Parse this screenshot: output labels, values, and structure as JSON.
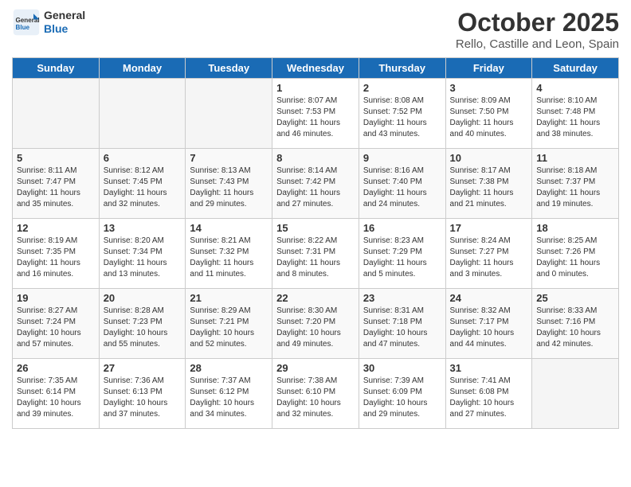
{
  "header": {
    "logo_line1": "General",
    "logo_line2": "Blue",
    "month": "October 2025",
    "location": "Rello, Castille and Leon, Spain"
  },
  "days_of_week": [
    "Sunday",
    "Monday",
    "Tuesday",
    "Wednesday",
    "Thursday",
    "Friday",
    "Saturday"
  ],
  "weeks": [
    [
      {
        "day": "",
        "empty": true
      },
      {
        "day": "",
        "empty": true
      },
      {
        "day": "",
        "empty": true
      },
      {
        "day": "1",
        "sunrise": "8:07 AM",
        "sunset": "7:53 PM",
        "daylight": "11 hours and 46 minutes."
      },
      {
        "day": "2",
        "sunrise": "8:08 AM",
        "sunset": "7:52 PM",
        "daylight": "11 hours and 43 minutes."
      },
      {
        "day": "3",
        "sunrise": "8:09 AM",
        "sunset": "7:50 PM",
        "daylight": "11 hours and 40 minutes."
      },
      {
        "day": "4",
        "sunrise": "8:10 AM",
        "sunset": "7:48 PM",
        "daylight": "11 hours and 38 minutes."
      }
    ],
    [
      {
        "day": "5",
        "sunrise": "8:11 AM",
        "sunset": "7:47 PM",
        "daylight": "11 hours and 35 minutes."
      },
      {
        "day": "6",
        "sunrise": "8:12 AM",
        "sunset": "7:45 PM",
        "daylight": "11 hours and 32 minutes."
      },
      {
        "day": "7",
        "sunrise": "8:13 AM",
        "sunset": "7:43 PM",
        "daylight": "11 hours and 29 minutes."
      },
      {
        "day": "8",
        "sunrise": "8:14 AM",
        "sunset": "7:42 PM",
        "daylight": "11 hours and 27 minutes."
      },
      {
        "day": "9",
        "sunrise": "8:16 AM",
        "sunset": "7:40 PM",
        "daylight": "11 hours and 24 minutes."
      },
      {
        "day": "10",
        "sunrise": "8:17 AM",
        "sunset": "7:38 PM",
        "daylight": "11 hours and 21 minutes."
      },
      {
        "day": "11",
        "sunrise": "8:18 AM",
        "sunset": "7:37 PM",
        "daylight": "11 hours and 19 minutes."
      }
    ],
    [
      {
        "day": "12",
        "sunrise": "8:19 AM",
        "sunset": "7:35 PM",
        "daylight": "11 hours and 16 minutes."
      },
      {
        "day": "13",
        "sunrise": "8:20 AM",
        "sunset": "7:34 PM",
        "daylight": "11 hours and 13 minutes."
      },
      {
        "day": "14",
        "sunrise": "8:21 AM",
        "sunset": "7:32 PM",
        "daylight": "11 hours and 11 minutes."
      },
      {
        "day": "15",
        "sunrise": "8:22 AM",
        "sunset": "7:31 PM",
        "daylight": "11 hours and 8 minutes."
      },
      {
        "day": "16",
        "sunrise": "8:23 AM",
        "sunset": "7:29 PM",
        "daylight": "11 hours and 5 minutes."
      },
      {
        "day": "17",
        "sunrise": "8:24 AM",
        "sunset": "7:27 PM",
        "daylight": "11 hours and 3 minutes."
      },
      {
        "day": "18",
        "sunrise": "8:25 AM",
        "sunset": "7:26 PM",
        "daylight": "11 hours and 0 minutes."
      }
    ],
    [
      {
        "day": "19",
        "sunrise": "8:27 AM",
        "sunset": "7:24 PM",
        "daylight": "10 hours and 57 minutes."
      },
      {
        "day": "20",
        "sunrise": "8:28 AM",
        "sunset": "7:23 PM",
        "daylight": "10 hours and 55 minutes."
      },
      {
        "day": "21",
        "sunrise": "8:29 AM",
        "sunset": "7:21 PM",
        "daylight": "10 hours and 52 minutes."
      },
      {
        "day": "22",
        "sunrise": "8:30 AM",
        "sunset": "7:20 PM",
        "daylight": "10 hours and 49 minutes."
      },
      {
        "day": "23",
        "sunrise": "8:31 AM",
        "sunset": "7:18 PM",
        "daylight": "10 hours and 47 minutes."
      },
      {
        "day": "24",
        "sunrise": "8:32 AM",
        "sunset": "7:17 PM",
        "daylight": "10 hours and 44 minutes."
      },
      {
        "day": "25",
        "sunrise": "8:33 AM",
        "sunset": "7:16 PM",
        "daylight": "10 hours and 42 minutes."
      }
    ],
    [
      {
        "day": "26",
        "sunrise": "7:35 AM",
        "sunset": "6:14 PM",
        "daylight": "10 hours and 39 minutes."
      },
      {
        "day": "27",
        "sunrise": "7:36 AM",
        "sunset": "6:13 PM",
        "daylight": "10 hours and 37 minutes."
      },
      {
        "day": "28",
        "sunrise": "7:37 AM",
        "sunset": "6:12 PM",
        "daylight": "10 hours and 34 minutes."
      },
      {
        "day": "29",
        "sunrise": "7:38 AM",
        "sunset": "6:10 PM",
        "daylight": "10 hours and 32 minutes."
      },
      {
        "day": "30",
        "sunrise": "7:39 AM",
        "sunset": "6:09 PM",
        "daylight": "10 hours and 29 minutes."
      },
      {
        "day": "31",
        "sunrise": "7:41 AM",
        "sunset": "6:08 PM",
        "daylight": "10 hours and 27 minutes."
      },
      {
        "day": "",
        "empty": true
      }
    ]
  ]
}
